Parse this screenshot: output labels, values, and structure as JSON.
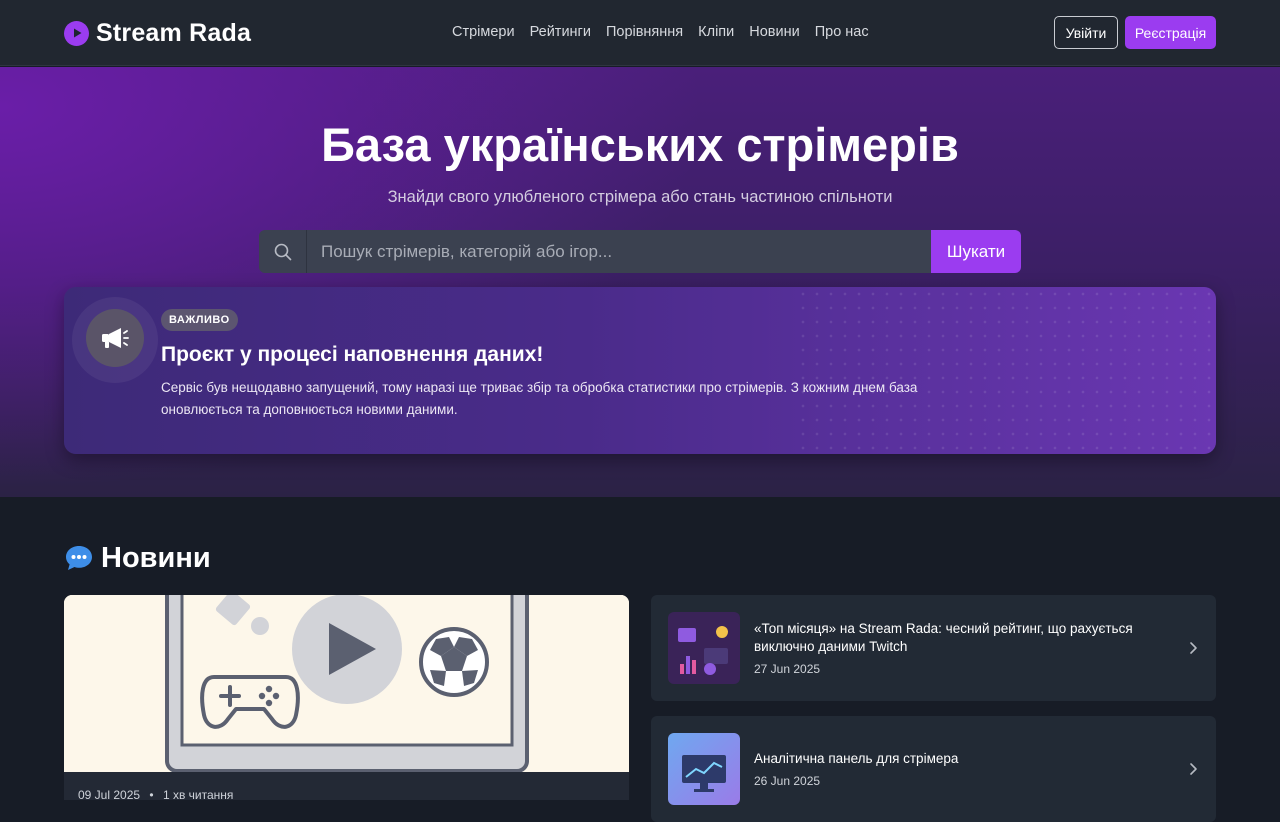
{
  "nav": {
    "brand": "Stream Rada",
    "links": [
      "Стрімери",
      "Рейтинги",
      "Порівняння",
      "Кліпи",
      "Новини",
      "Про нас"
    ],
    "login": "Увійти",
    "register": "Реєстрація"
  },
  "hero": {
    "title": "База українських стрімерів",
    "subtitle": "Знайди свого улюбленого стрімера або стань частиною спільноти",
    "search_placeholder": "Пошук стрімерів, категорій або ігор...",
    "search_button": "Шукати"
  },
  "alert": {
    "badge": "ВАЖЛИВО",
    "title": "Проєкт у процесі наповнення даних!",
    "text": "Сервіс був нещодавно запущений, тому наразі ще триває збір та обробка статистики про стрімерів. З кожним днем база оновлюється та доповнюється новими даними."
  },
  "news": {
    "heading": "Новини",
    "featured": {
      "date": "09 Jul 2025",
      "read_time": "1 хв читання"
    },
    "items": [
      {
        "title": "«Топ місяця» на Stream Rada: чесний рейтинг, що рахується виключно даними Twitch",
        "date": "27 Jun 2025"
      },
      {
        "title": "Аналітична панель для стрімера",
        "date": "26 Jun 2025"
      }
    ]
  },
  "colors": {
    "accent": "#9b3cf0",
    "nav_bg": "#212730",
    "page_bg": "#171c26",
    "card_bg": "#222a35"
  }
}
